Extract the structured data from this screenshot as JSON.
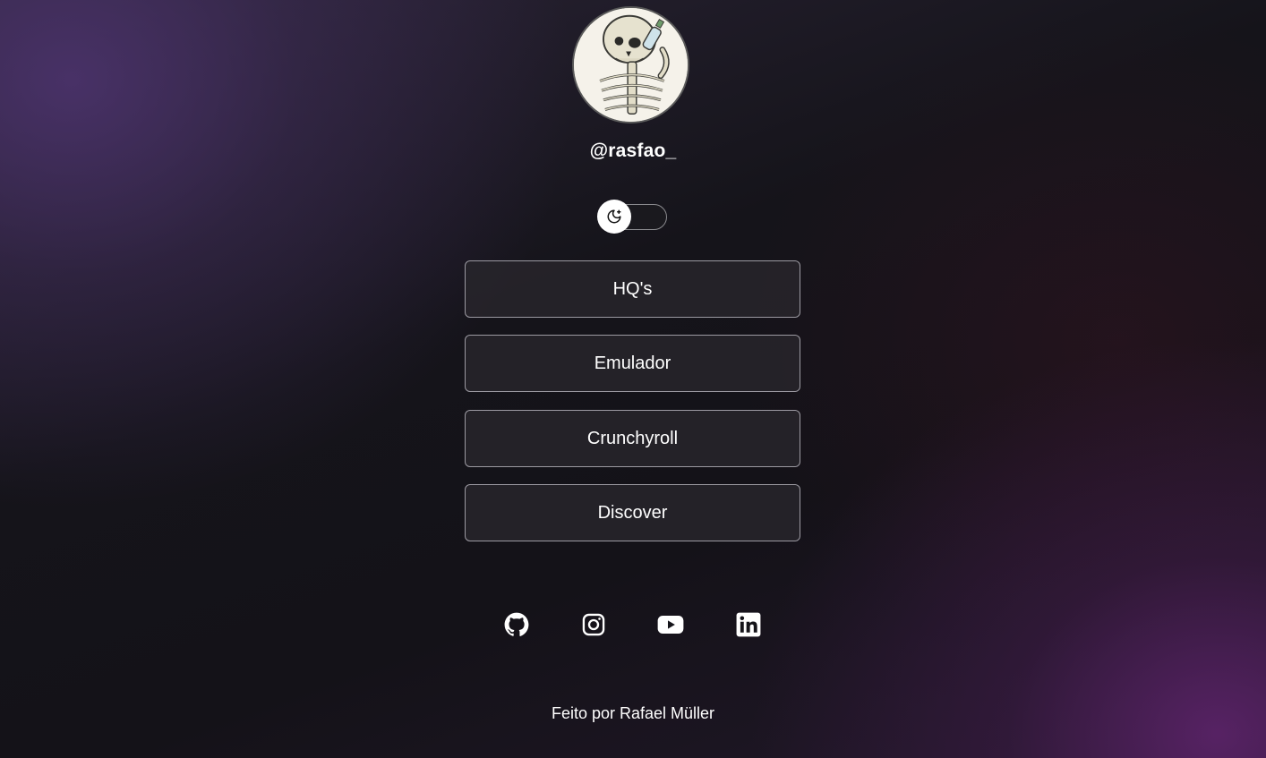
{
  "profile": {
    "username": "@rasfao_",
    "avatar_icon": "skeleton-avatar"
  },
  "theme_toggle": {
    "icon": "moon-stars-icon",
    "state": "dark"
  },
  "links": [
    {
      "label": "HQ's"
    },
    {
      "label": "Emulador"
    },
    {
      "label": "Crunchyroll"
    },
    {
      "label": "Discover"
    }
  ],
  "socials": [
    {
      "icon": "github-icon"
    },
    {
      "icon": "instagram-icon"
    },
    {
      "icon": "youtube-icon"
    },
    {
      "icon": "linkedin-icon"
    }
  ],
  "footer": {
    "text": "Feito por Rafael Müller"
  },
  "colors": {
    "background": "#121116",
    "button_bg": "#28262c",
    "button_border": "#9c9aa2",
    "accent_purple": "#4e3470"
  }
}
